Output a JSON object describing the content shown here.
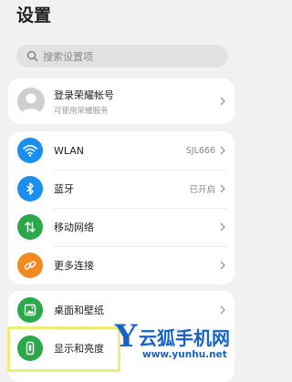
{
  "page": {
    "title": "设置"
  },
  "search": {
    "placeholder": "搜索设置项"
  },
  "account": {
    "title": "登录荣耀帐号",
    "subtitle": "可使用荣耀服务"
  },
  "network": [
    {
      "label": "WLAN",
      "value": "SJL666",
      "icon": "wifi-icon",
      "color": "#1a8ff0"
    },
    {
      "label": "蓝牙",
      "value": "已开启",
      "icon": "bluetooth-icon",
      "color": "#1a8ff0"
    },
    {
      "label": "移动网络",
      "value": "",
      "icon": "mobile-network-icon",
      "color": "#2aa84a"
    },
    {
      "label": "更多连接",
      "value": "",
      "icon": "link-icon",
      "color": "#f28a22"
    }
  ],
  "personal": [
    {
      "label": "桌面和壁纸",
      "icon": "wallpaper-icon",
      "color": "#2aa84a"
    },
    {
      "label": "显示和亮度",
      "icon": "display-icon",
      "color": "#2aa84a"
    }
  ],
  "watermark": {
    "logo": "Y",
    "name": "云狐手机网",
    "url": "www.yunhu.net",
    "color": "#1663c5"
  }
}
